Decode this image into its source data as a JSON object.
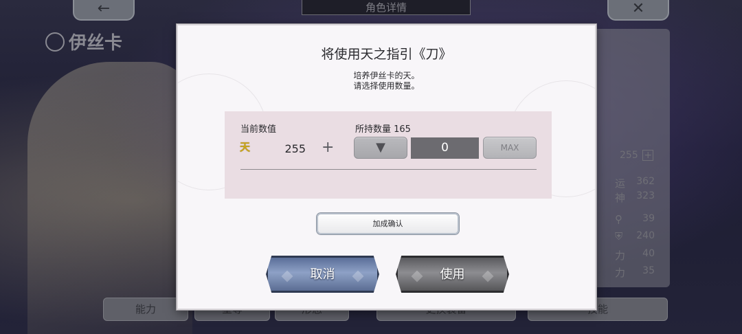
{
  "background": {
    "header_title": "角色详情",
    "back_icon": "left-arrow-icon",
    "close_icon": "close-x-icon",
    "character_name": "伊丝卡",
    "tian_value": "255",
    "stats": [
      {
        "label": "运",
        "value": "362"
      },
      {
        "label": "神",
        "value": "323"
      },
      {
        "label": "",
        "value": "39"
      },
      {
        "label": "",
        "value": "240"
      },
      {
        "label": "力",
        "value": "40"
      },
      {
        "label": "力",
        "value": "35"
      }
    ],
    "tabs": [
      "能力",
      "星等",
      "形态",
      "更换装备",
      "技能"
    ]
  },
  "dialog": {
    "title": "将使用天之指引《刀》",
    "desc_line1": "培养伊丝卡的天。",
    "desc_line2": "请选择使用数量。",
    "current_label": "当前数值",
    "owned_label": "所持数量 165",
    "tian_glyph": "天",
    "current_value": "255",
    "plus": "+",
    "decrease_glyph": "▼",
    "quantity": "0",
    "max_label": "MAX",
    "confirm_bonus_label": "加成确认",
    "cancel_label": "取消",
    "use_label": "使用"
  },
  "colors": {
    "dialog_bg": "#f8f6f9",
    "panel_bg": "#eadde3",
    "qty_bg": "#6c6b70",
    "cancel_btn": "#7b8db3",
    "use_btn": "#747478"
  }
}
